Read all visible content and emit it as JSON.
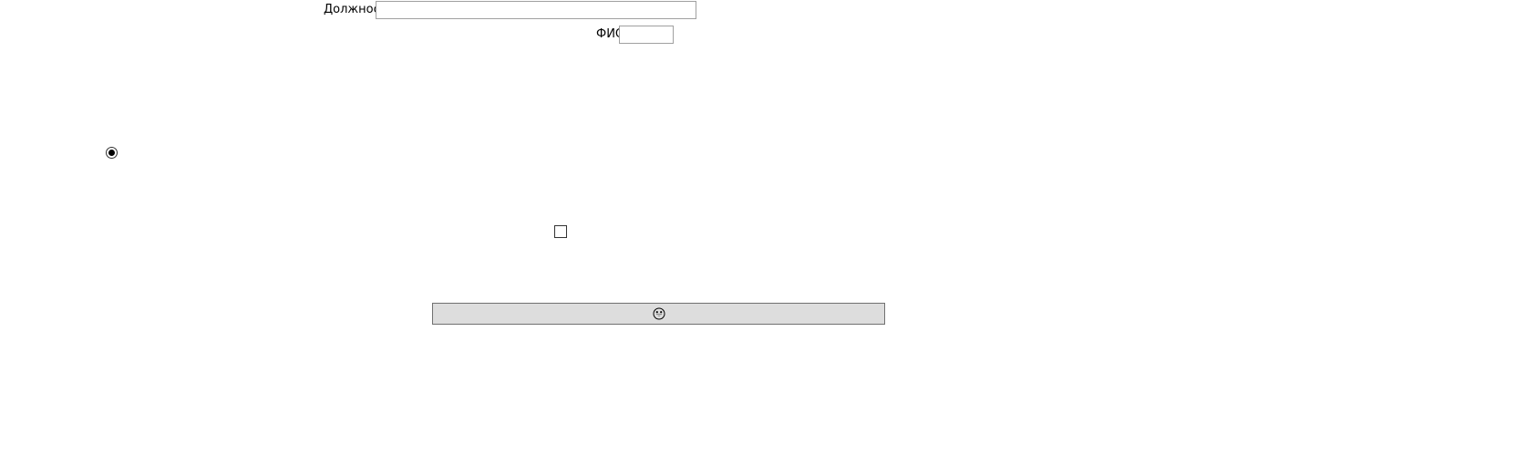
{
  "form": {
    "position_label": "Должность",
    "position_value": "",
    "name_label": "ФИО",
    "name_value": ""
  },
  "radio": {
    "checked": true
  },
  "checkbox": {
    "checked": false
  },
  "button": {
    "icon": "smiling-face-icon"
  }
}
